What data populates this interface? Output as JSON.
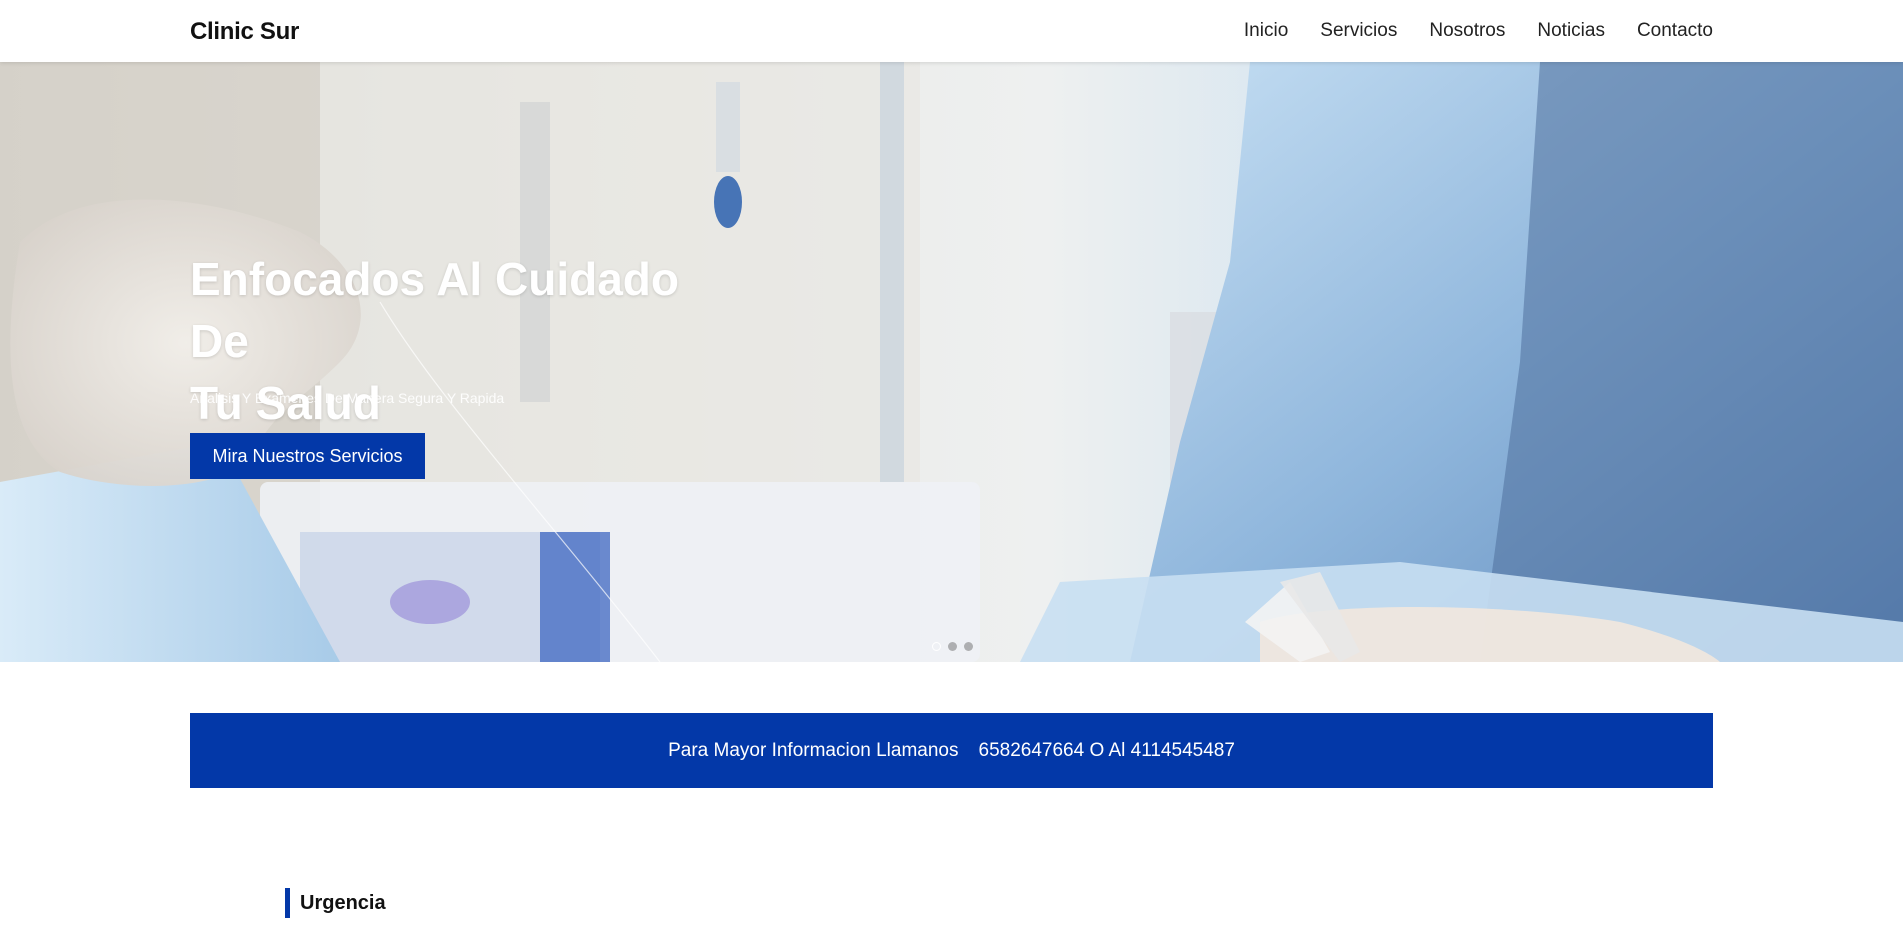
{
  "brand": "Clinic Sur",
  "nav": {
    "items": [
      "Inicio",
      "Servicios",
      "Nosotros",
      "Noticias",
      "Contacto"
    ]
  },
  "hero": {
    "title_line1": "Enfocados Al Cuidado De",
    "title_line2": "Tu Salud",
    "subtitle": "Analisis Y Examenes De Manera Segura Y Rapida",
    "cta_label": "Mira Nuestros Servicios",
    "slides_count": 3,
    "active_slide": 1
  },
  "info_bar": {
    "label": "Para Mayor Informacion Llamanos",
    "phones": "6582647664 O Al 4114545487"
  },
  "section": {
    "title": "Urgencia"
  },
  "colors": {
    "primary": "#0338a8",
    "background": "#ffffff",
    "text": "#111111"
  }
}
